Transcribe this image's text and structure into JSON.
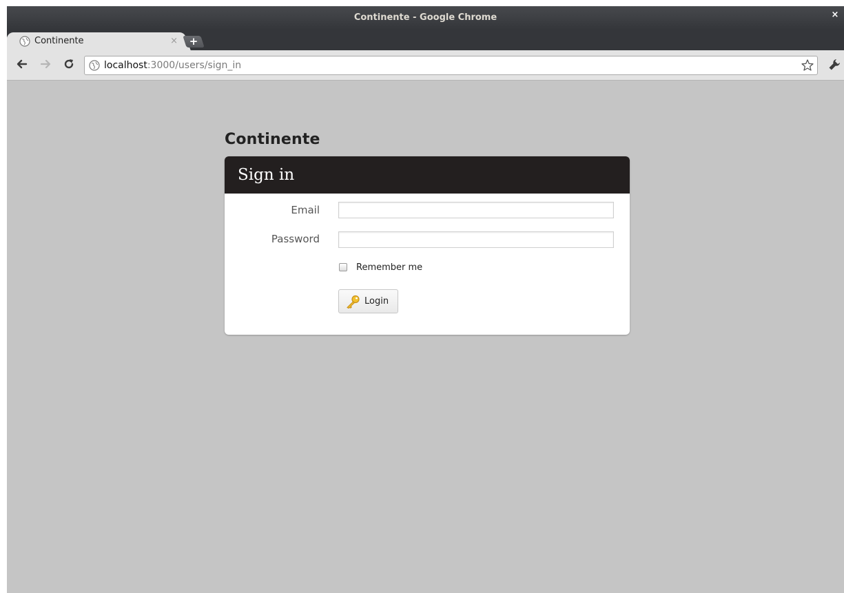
{
  "window": {
    "title": "Continente - Google Chrome",
    "close_label": "×"
  },
  "tab": {
    "title": "Continente",
    "close_label": "×",
    "favicon": "globe-icon"
  },
  "newtab": {
    "label": "+"
  },
  "omnibox": {
    "host": "localhost",
    "path": ":3000/users/sign_in"
  },
  "page": {
    "app_title": "Continente",
    "form": {
      "heading": "Sign in",
      "email_label": "Email",
      "email_value": "",
      "password_label": "Password",
      "password_value": "",
      "remember_label": "Remember me",
      "remember_checked": false,
      "login_label": "Login"
    }
  },
  "colors": {
    "page_background": "#c5c5c5",
    "card_header": "#231f1f",
    "chrome_frame": "#34363a"
  }
}
